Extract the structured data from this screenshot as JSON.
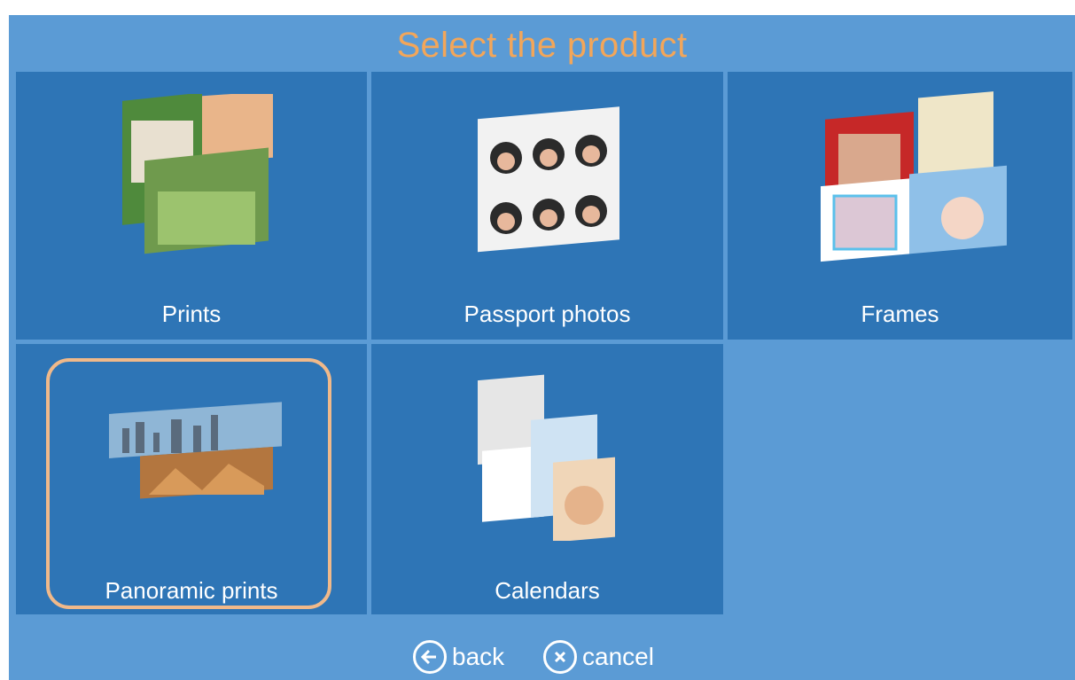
{
  "title": "Select the product",
  "products": [
    {
      "label": "Prints",
      "icon": "prints-thumbnail-icon"
    },
    {
      "label": "Passport photos",
      "icon": "passport-photos-thumbnail-icon"
    },
    {
      "label": "Frames",
      "icon": "frames-thumbnail-icon"
    },
    {
      "label": "Panoramic prints",
      "icon": "panoramic-thumbnail-icon",
      "selected": true
    },
    {
      "label": "Calendars",
      "icon": "calendars-thumbnail-icon"
    }
  ],
  "footer": {
    "back_label": "back",
    "cancel_label": "cancel"
  },
  "colors": {
    "background": "#5b9bd5",
    "tile": "#2e75b6",
    "title": "#f2a65a",
    "highlight": "#f0b98a"
  }
}
